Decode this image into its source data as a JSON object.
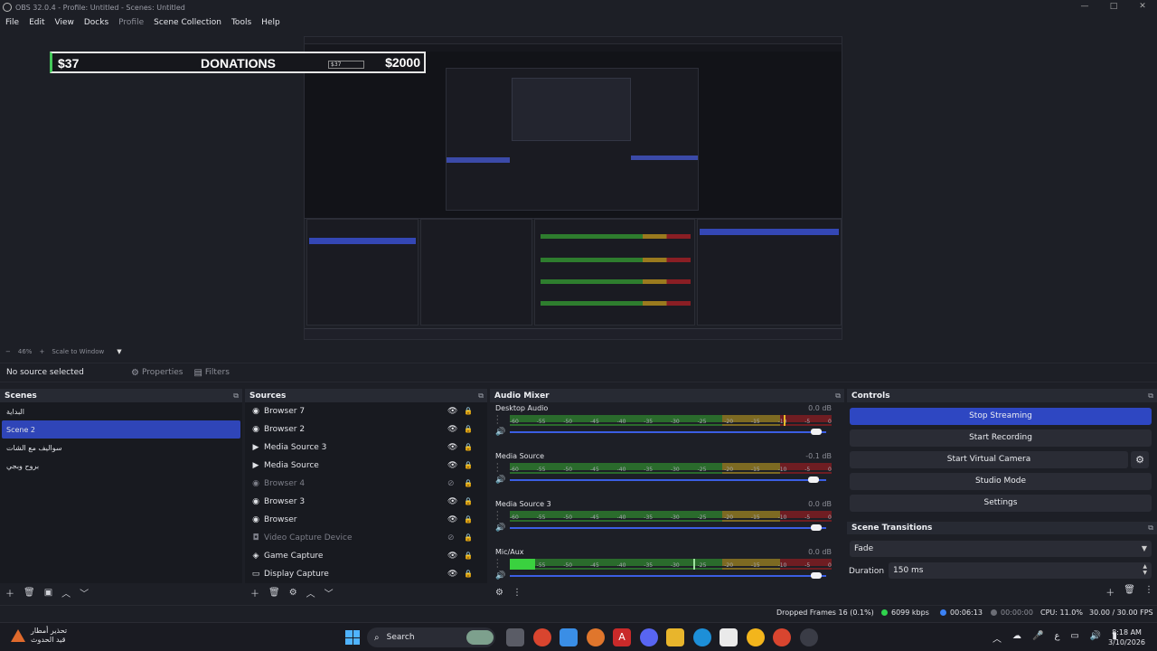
{
  "window": {
    "title": "OBS 32.0.4 - Profile: Untitled - Scenes: Untitled",
    "controls": [
      "—",
      "□",
      "✕"
    ]
  },
  "menu": {
    "items": [
      "File",
      "Edit",
      "View",
      "Docks",
      "Profile",
      "Scene Collection",
      "Tools",
      "Help"
    ]
  },
  "preview": {
    "donation_current": "$37",
    "donation_label": "DONATIONS",
    "donation_goal": "$2000",
    "nested_current": "$37"
  },
  "zoom": {
    "minus": "−",
    "value": "46%",
    "plus": "+",
    "mode": "Scale to Window"
  },
  "source_toolbar": {
    "status": "No source selected",
    "properties": "Properties",
    "filters": "Filters"
  },
  "scenes": {
    "title": "Scenes",
    "items": [
      {
        "name": "البداية",
        "active": false
      },
      {
        "name": "Scene 2",
        "active": true
      },
      {
        "name": "سواليف مع الشات",
        "active": false
      },
      {
        "name": "بروح وبجي",
        "active": false
      }
    ]
  },
  "sources": {
    "title": "Sources",
    "items": [
      {
        "name": "Browser 7",
        "icon": "globe-icon",
        "visible": true
      },
      {
        "name": "Browser 2",
        "icon": "globe-icon",
        "visible": true
      },
      {
        "name": "Media Source 3",
        "icon": "play-icon",
        "visible": true
      },
      {
        "name": "Media Source",
        "icon": "play-icon",
        "visible": true
      },
      {
        "name": "Browser 4",
        "icon": "globe-icon",
        "visible": false
      },
      {
        "name": "Browser 3",
        "icon": "globe-icon",
        "visible": true
      },
      {
        "name": "Browser",
        "icon": "globe-icon",
        "visible": true
      },
      {
        "name": "Video Capture Device",
        "icon": "camera-icon",
        "visible": false
      },
      {
        "name": "Game Capture",
        "icon": "gamepad-icon",
        "visible": true
      },
      {
        "name": "Display Capture",
        "icon": "monitor-icon",
        "visible": true
      }
    ]
  },
  "mixer": {
    "title": "Audio Mixer",
    "scale": [
      "-60",
      "-55",
      "-50",
      "-45",
      "-40",
      "-35",
      "-30",
      "-25",
      "-20",
      "-15",
      "-10",
      "-5",
      "0"
    ],
    "channels": [
      {
        "name": "Desktop Audio",
        "db": "0.0 dB",
        "level": 0.0,
        "peak": 0.85,
        "fader": 0.98
      },
      {
        "name": "Media Source",
        "db": "-0.1 dB",
        "level": 0.0,
        "peak": null,
        "fader": 0.97
      },
      {
        "name": "Media Source 3",
        "db": "0.0 dB",
        "level": 0.0,
        "peak": null,
        "fader": 0.98
      },
      {
        "name": "Mic/Aux",
        "db": "0.0 dB",
        "level": 0.08,
        "peak": 0.57,
        "fader": 0.98
      }
    ]
  },
  "controls": {
    "title": "Controls",
    "stop_streaming": "Stop Streaming",
    "start_recording": "Start Recording",
    "start_virtual_camera": "Start Virtual Camera",
    "studio_mode": "Studio Mode",
    "settings": "Settings"
  },
  "transitions": {
    "title": "Scene Transitions",
    "selected": "Fade",
    "duration_label": "Duration",
    "duration_value": "150 ms"
  },
  "status": {
    "dropped": "Dropped Frames 16 (0.1%)",
    "bitrate": "6099 kbps",
    "stream_time": "00:06:13",
    "rec_time": "00:00:00",
    "cpu": "CPU: 11.0%",
    "fps": "30.00 / 30.00 FPS",
    "colors": {
      "good": "#2fd34d",
      "live": "#3b82f6",
      "idle": "#6b6d75"
    }
  },
  "taskbar": {
    "weather_line1": "تحذير أمطار",
    "weather_line2": "قيد الحدوث",
    "search": "Search",
    "time": "8:18 AM",
    "date": "3/10/2026"
  }
}
